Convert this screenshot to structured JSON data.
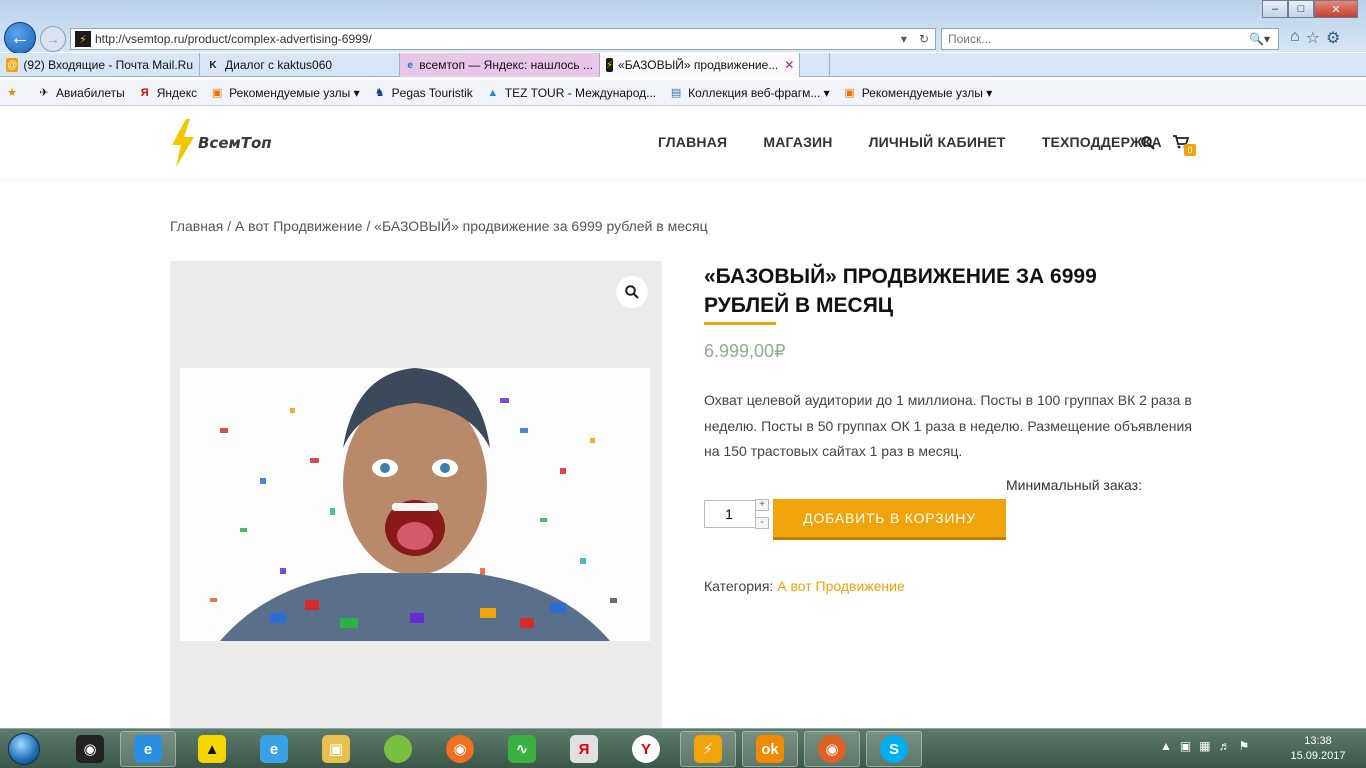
{
  "browser": {
    "url": "http://vsemtop.ru/product/complex-advertising-6999/",
    "search_placeholder": "Поиск...",
    "tabs": [
      {
        "label": "(92) Входящие - Почта Mail.Ru",
        "icon": "mail-icon"
      },
      {
        "label": "Диалог с kaktus060",
        "icon": "k-icon"
      },
      {
        "label": "всемтоп — Яндекс: нашлось ...",
        "icon": "ie-icon"
      },
      {
        "label": "«БАЗОВЫЙ» продвижение...",
        "icon": "bolt-icon"
      }
    ],
    "favorites": [
      {
        "label": "Авиабилеты"
      },
      {
        "label": "Яндекс"
      },
      {
        "label": "Рекомендуемые узлы ▾"
      },
      {
        "label": "Pegas Touristik"
      },
      {
        "label": "TEZ TOUR - Международ..."
      },
      {
        "label": "Коллекция веб-фрагм... ▾"
      },
      {
        "label": "Рекомендуемые узлы ▾"
      }
    ]
  },
  "site": {
    "logo_text": "ВсемТоп",
    "nav": [
      "ГЛАВНАЯ",
      "МАГАЗИН",
      "ЛИЧНЫЙ КАБИНЕТ",
      "ТЕХПОДДЕРЖКА"
    ],
    "cart_count": "0",
    "accent_color": "#f0a30a"
  },
  "breadcrumb": "Главная / А вот Продвижение / «БАЗОВЫЙ» продвижение за 6999 рублей в месяц",
  "product": {
    "title_bold": "«БАЗОВЫЙ»",
    "title_rest": " ПРОДВИЖЕНИЕ ЗА 6999 РУБЛЕЙ В МЕСЯЦ",
    "price": "6.999,00₽",
    "description": "Охват целевой аудитории до 1 миллиона. Посты в 100 группах ВК 2 раза в неделю. Посты в 50 группах ОК 1 раза в неделю. Размещение объявления на 150 трастовых сайтах 1 раз в месяц.",
    "min_order_label": "Минимальный заказ:",
    "quantity": "1",
    "add_to_cart": "ДОБАВИТЬ В КОРЗИНУ",
    "category_label": "Категория: ",
    "category_value": "А вот Продвижение"
  },
  "taskbar": {
    "time": "13:38",
    "date": "15.09.2017"
  }
}
